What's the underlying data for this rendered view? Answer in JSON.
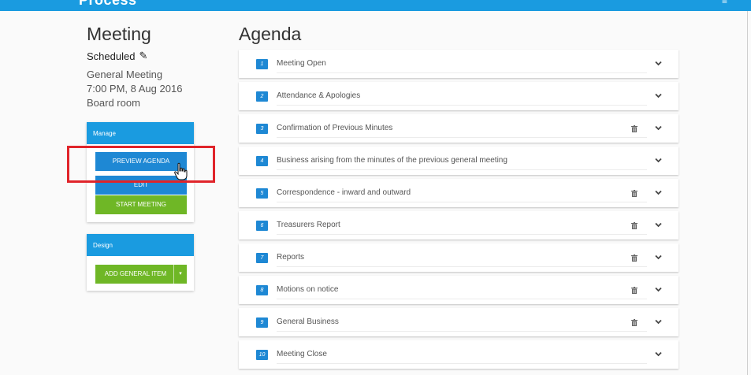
{
  "app": {
    "brand": "Process"
  },
  "meeting": {
    "heading": "Meeting",
    "status": "Scheduled",
    "type": "General Meeting",
    "datetime": "7:00 PM, 8 Aug 2016",
    "location": "Board room"
  },
  "manage": {
    "header": "Manage",
    "preview_label": "PREVIEW AGENDA",
    "edit_label": "EDIT",
    "start_label": "START MEETING"
  },
  "design": {
    "header": "Design",
    "add_label": "ADD GENERAL ITEM",
    "caret": "▾"
  },
  "agenda": {
    "heading": "Agenda",
    "items": [
      {
        "number": "1",
        "title": "Meeting Open",
        "deletable": false
      },
      {
        "number": "2",
        "title": "Attendance & Apologies",
        "deletable": false
      },
      {
        "number": "3",
        "title": "Confirmation of Previous Minutes",
        "deletable": true
      },
      {
        "number": "4",
        "title": "Business arising from the minutes of the previous general meeting",
        "deletable": false
      },
      {
        "number": "5",
        "title": "Correspondence - inward and outward",
        "deletable": true
      },
      {
        "number": "6",
        "title": "Treasurers Report",
        "deletable": true
      },
      {
        "number": "7",
        "title": "Reports",
        "deletable": true
      },
      {
        "number": "8",
        "title": "Motions on notice",
        "deletable": true
      },
      {
        "number": "9",
        "title": "General Business",
        "deletable": true
      },
      {
        "number": "10",
        "title": "Meeting Close",
        "deletable": false
      }
    ]
  },
  "icons": {
    "edit_status": "pencil-icon",
    "delete": "trash-icon",
    "expand": "chevron-down-icon",
    "cursor": "hand-cursor-icon"
  },
  "colors": {
    "brand_blue": "#1a9be0",
    "button_blue": "#1e88d4",
    "button_green": "#6fb726",
    "highlight_red": "#e0242a"
  }
}
